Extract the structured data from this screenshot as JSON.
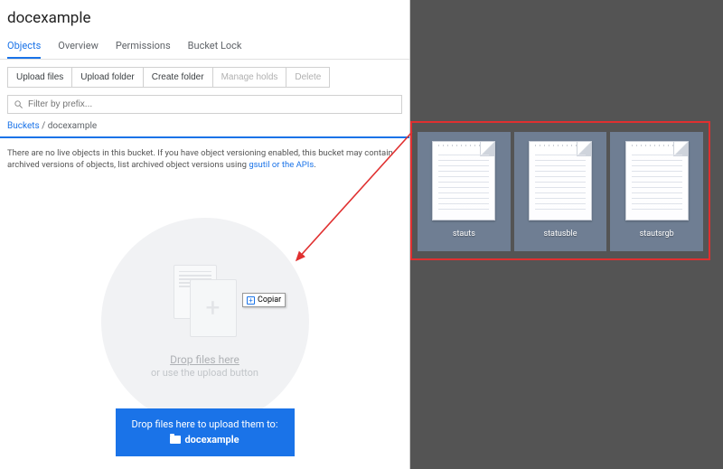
{
  "page_title": "docexample",
  "tabs": {
    "objects": "Objects",
    "overview": "Overview",
    "permissions": "Permissions",
    "bucket_lock": "Bucket Lock"
  },
  "toolbar": {
    "upload_files": "Upload files",
    "upload_folder": "Upload folder",
    "create_folder": "Create folder",
    "manage_holds": "Manage holds",
    "delete": "Delete"
  },
  "filter": {
    "placeholder": "Filter by prefix..."
  },
  "breadcrumb": {
    "root": "Buckets",
    "sep": " / ",
    "current": "docexample"
  },
  "empty_msg": {
    "pre": "There are no live objects in this bucket. If you have object versioning enabled, this bucket may contain archived versions of objects, list archived object versions using ",
    "link": "gsutil or the APIs",
    "post": "."
  },
  "drop": {
    "title": "Drop files here",
    "sub": "or use the upload button"
  },
  "upload_banner": {
    "line1": "Drop files here to upload them to:",
    "bucket": "docexample"
  },
  "copy_cursor": "Copiar",
  "desktop_files": {
    "f1": "stauts",
    "f2": "statusble",
    "f3": "stautsrgb"
  }
}
